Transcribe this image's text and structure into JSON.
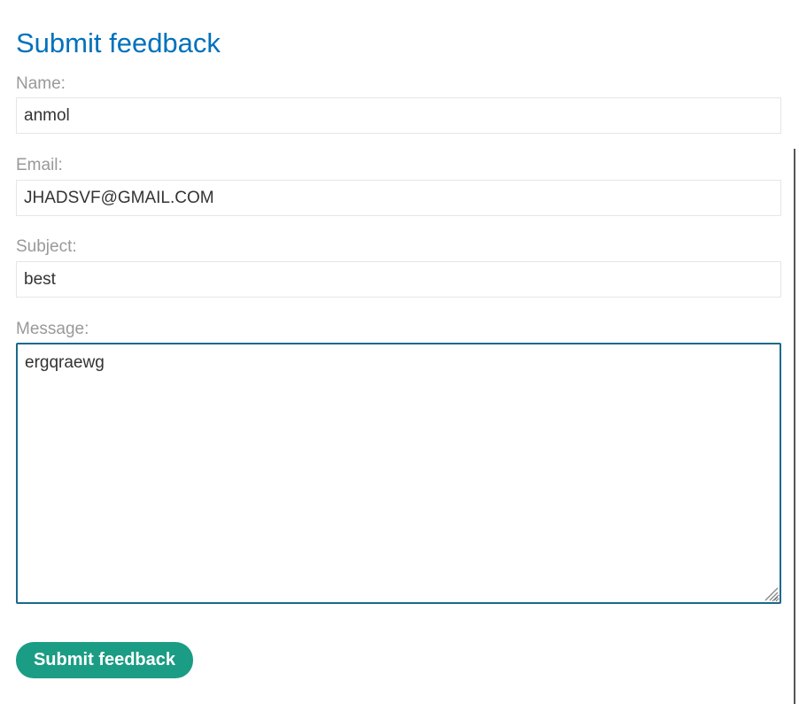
{
  "form": {
    "title": "Submit feedback",
    "name": {
      "label": "Name:",
      "value": "anmol"
    },
    "email": {
      "label": "Email:",
      "value": "JHADSVF@GMAIL.COM"
    },
    "subject": {
      "label": "Subject:",
      "value": "best"
    },
    "message": {
      "label": "Message:",
      "value": "ergqraewg"
    },
    "submit_label": "Submit feedback"
  },
  "colors": {
    "title": "#0071bc",
    "label": "#999999",
    "button": "#1b9c85",
    "focus_border": "#1a6a8c"
  }
}
